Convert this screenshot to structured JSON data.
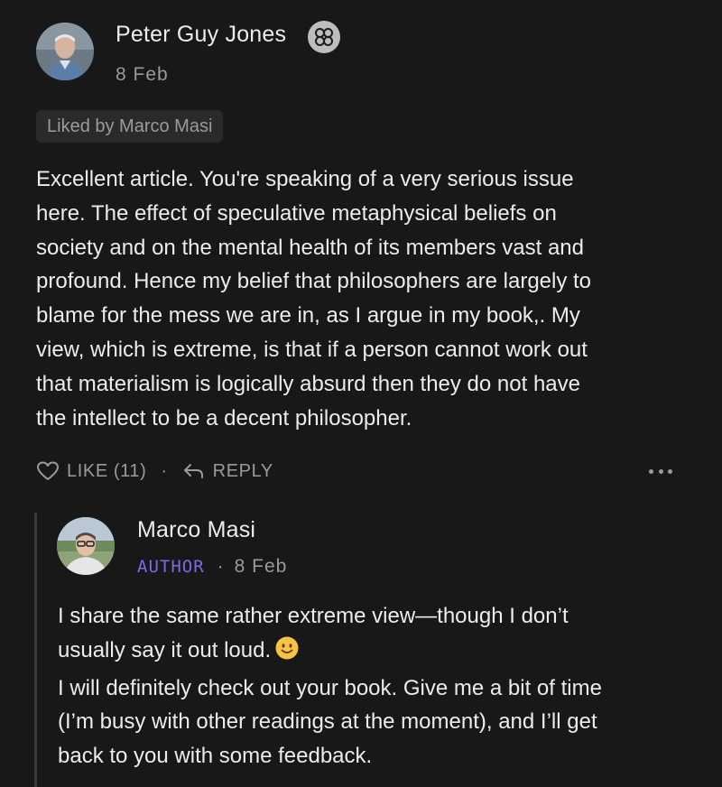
{
  "comment": {
    "author": "Peter Guy Jones",
    "badge_icon": "subscriber-badge-icon",
    "date": "8 Feb",
    "liked_by": "Liked by Marco Masi",
    "body_lines": [
      "Excellent article. You're speaking of a very serious issue",
      "here. The effect of speculative metaphysical beliefs on",
      "society and on the mental health of its members vast and",
      "profound. Hence my belief that philosophers are largely to",
      "blame for the mess we are in, as I argue in my book,. My",
      "view, which is extreme, is that if a person cannot work out",
      "that materialism is logically absurd then they do not have",
      "the intellect to be a decent philosopher."
    ],
    "actions": {
      "like_label": "LIKE (11)",
      "separator": "·",
      "reply_label": "REPLY",
      "more_icon": "more-dots-icon"
    }
  },
  "reply": {
    "author": "Marco Masi",
    "author_tag": "AUTHOR",
    "separator": "·",
    "date": "8 Feb",
    "body_lines": [
      "I share the same rather extreme view—though I don’t",
      "usually say it out loud.",
      "I will definitely check out your book. Give me a bit of time",
      "(I’m busy with other readings at the moment), and I’ll get",
      "back to you with some feedback."
    ],
    "emoji": "slightly-smiling-face-emoji"
  },
  "colors": {
    "background": "#181819",
    "author_tag": "#7b6ae6",
    "muted_text": "#9b9b9b"
  }
}
